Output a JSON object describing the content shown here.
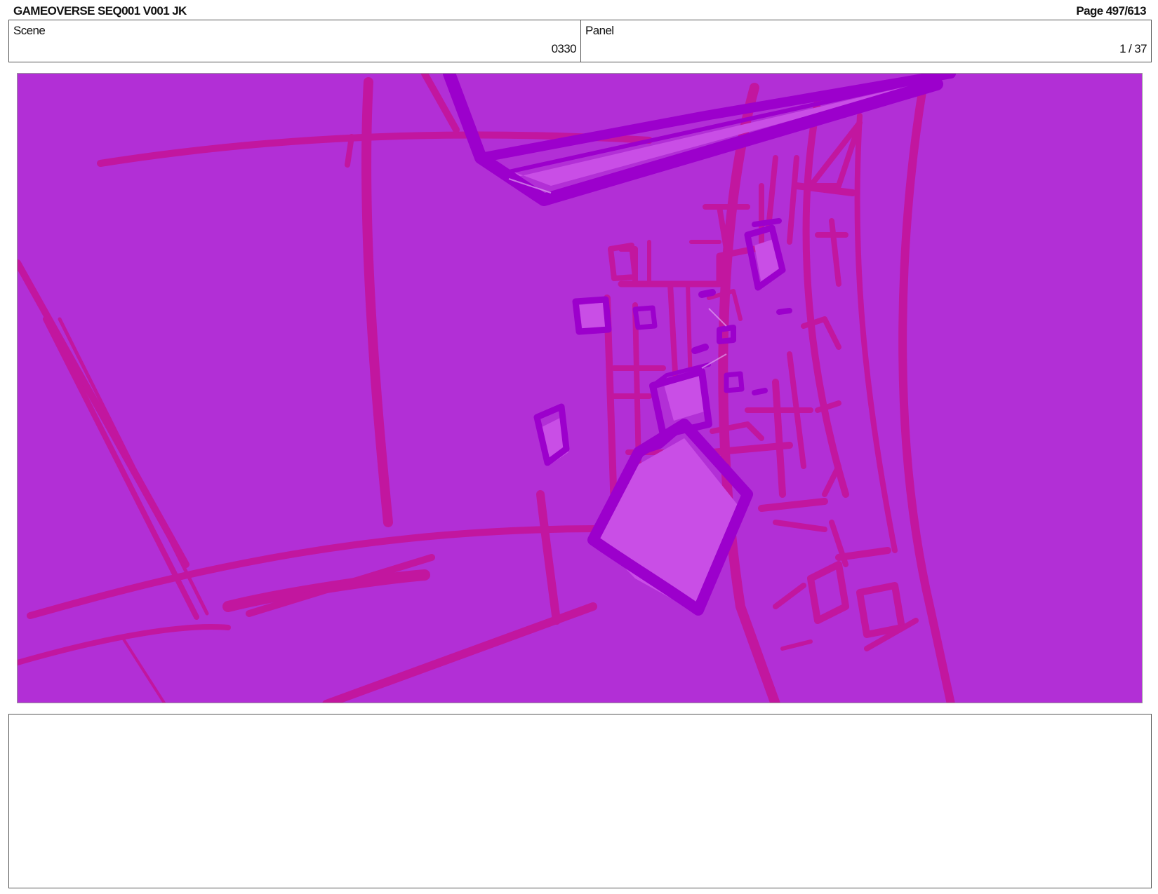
{
  "header": {
    "title": "GAMEOVERSE SEQ001 V001 JK",
    "page": "Page 497/613"
  },
  "info": {
    "scene_label": "Scene",
    "scene_value": "0330",
    "panel_label": "Panel",
    "panel_value": "1 / 37"
  },
  "artwork": {
    "description_icon": "storyboard-sketch",
    "colors": {
      "background": "#b22fd6",
      "magenta_lines": "#c2169f",
      "violet_lines": "#9c00cc",
      "highlight": "#c94ee6"
    }
  },
  "notes": {
    "text": ""
  }
}
